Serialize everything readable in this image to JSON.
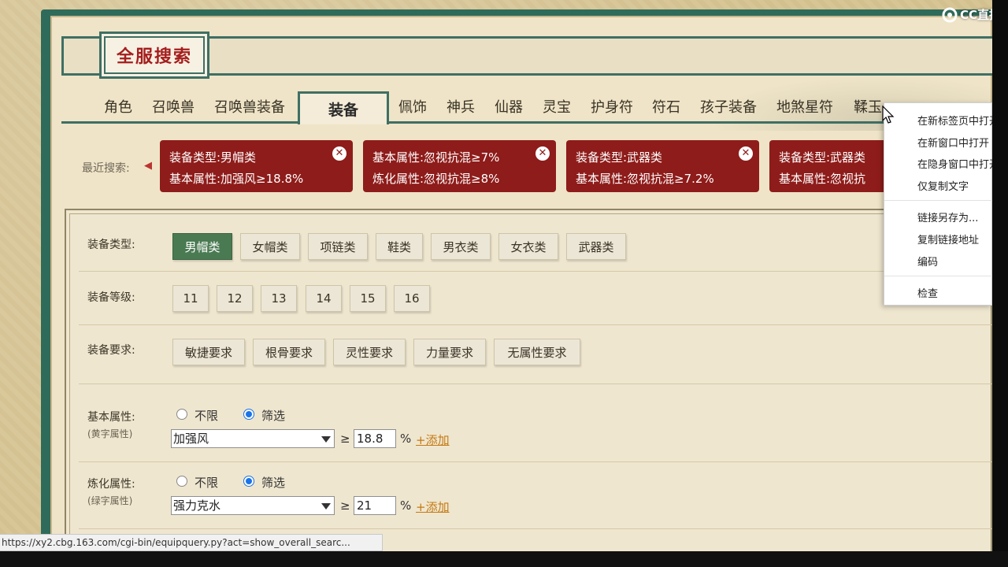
{
  "header": {
    "title": "全服搜索"
  },
  "tabs": [
    {
      "label": "角色"
    },
    {
      "label": "召唤兽"
    },
    {
      "label": "召唤兽装备"
    },
    {
      "label": "装备",
      "active": true
    },
    {
      "label": "佩饰"
    },
    {
      "label": "神兵"
    },
    {
      "label": "仙器"
    },
    {
      "label": "灵宝"
    },
    {
      "label": "护身符"
    },
    {
      "label": "符石"
    },
    {
      "label": "孩子装备"
    },
    {
      "label": "地煞星符"
    },
    {
      "label": "鞣玉"
    }
  ],
  "recent": {
    "label": "最近搜索:",
    "chips": [
      {
        "line1": "装备类型:男帽类",
        "line2": "基本属性:加强风≥18.8%"
      },
      {
        "line1": "基本属性:忽视抗混≥7%",
        "line2": "炼化属性:忽视抗混≥8%"
      },
      {
        "line1": "装备类型:武器类",
        "line2": "基本属性:忽视抗混≥7.2%"
      },
      {
        "line1": "装备类型:武器类",
        "line2": "基本属性:忽视抗"
      }
    ]
  },
  "filters": {
    "equip_type": {
      "label": "装备类型:",
      "options": [
        "男帽类",
        "女帽类",
        "项链类",
        "鞋类",
        "男衣类",
        "女衣类",
        "武器类"
      ],
      "selected": "男帽类"
    },
    "equip_level": {
      "label": "装备等级:",
      "options": [
        "11",
        "12",
        "13",
        "14",
        "15",
        "16"
      ]
    },
    "equip_req": {
      "label": "装备要求:",
      "options": [
        "敏捷要求",
        "根骨要求",
        "灵性要求",
        "力量要求",
        "无属性要求"
      ]
    },
    "base_attr": {
      "label": "基本属性:",
      "sublabel": "(黄字属性)",
      "radio_all": "不限",
      "radio_filter": "筛选",
      "selected_radio": "筛选",
      "select_value": "加强风",
      "ge": "≥",
      "input_value": "18.8",
      "unit": "%",
      "add_label": "+添加"
    },
    "refine_attr": {
      "label": "炼化属性:",
      "sublabel": "(绿字属性)",
      "radio_all": "不限",
      "radio_filter": "筛选",
      "selected_radio": "筛选",
      "select_value": "强力克水",
      "ge": "≥",
      "input_value": "21",
      "unit": "%",
      "add_label": "+添加"
    }
  },
  "context_menu": {
    "items": [
      {
        "label": "在新标签页中打开"
      },
      {
        "label": "在新窗口中打开"
      },
      {
        "label": "在隐身窗口中打开"
      },
      {
        "label": "仅复制文字"
      },
      {
        "label": "链接另存为..."
      },
      {
        "label": "复制链接地址"
      },
      {
        "label": "编码"
      },
      {
        "label": "检查"
      }
    ]
  },
  "status_bar": {
    "url": "https://xy2.cbg.163.com/cgi-bin/equipquery.py?act=show_overall_searc..."
  },
  "watermark": {
    "text": "CC直播"
  },
  "colors": {
    "accent_green": "#3f6f64",
    "chip_red": "#8e1c1a",
    "active_option": "#4a7a52",
    "link_orange": "#c47a12",
    "title_red": "#a41e1e"
  }
}
